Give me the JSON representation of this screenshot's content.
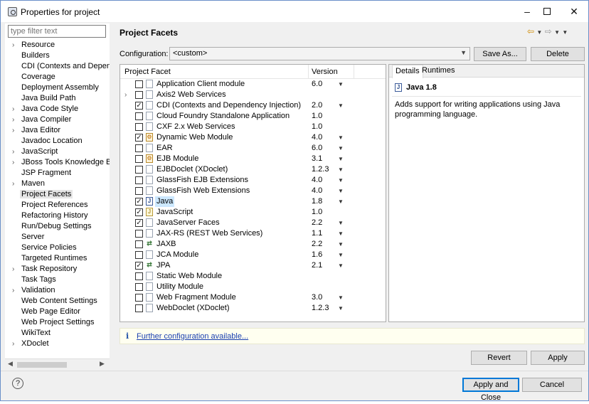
{
  "window": {
    "title": "Properties for project"
  },
  "filter": {
    "placeholder": "type filter text"
  },
  "sidebar": {
    "items": [
      {
        "label": "Resource",
        "expandable": true
      },
      {
        "label": "Builders",
        "expandable": false
      },
      {
        "label": "CDI (Contexts and Depende",
        "expandable": false
      },
      {
        "label": "Coverage",
        "expandable": false
      },
      {
        "label": "Deployment Assembly",
        "expandable": false
      },
      {
        "label": "Java Build Path",
        "expandable": false
      },
      {
        "label": "Java Code Style",
        "expandable": true
      },
      {
        "label": "Java Compiler",
        "expandable": true
      },
      {
        "label": "Java Editor",
        "expandable": true
      },
      {
        "label": "Javadoc Location",
        "expandable": false
      },
      {
        "label": "JavaScript",
        "expandable": true
      },
      {
        "label": "JBoss Tools Knowledge Bas",
        "expandable": true
      },
      {
        "label": "JSP Fragment",
        "expandable": false
      },
      {
        "label": "Maven",
        "expandable": true
      },
      {
        "label": "Project Facets",
        "expandable": false,
        "selected": true
      },
      {
        "label": "Project References",
        "expandable": false
      },
      {
        "label": "Refactoring History",
        "expandable": false
      },
      {
        "label": "Run/Debug Settings",
        "expandable": false
      },
      {
        "label": "Server",
        "expandable": false
      },
      {
        "label": "Service Policies",
        "expandable": false
      },
      {
        "label": "Targeted Runtimes",
        "expandable": false
      },
      {
        "label": "Task Repository",
        "expandable": true
      },
      {
        "label": "Task Tags",
        "expandable": false
      },
      {
        "label": "Validation",
        "expandable": true
      },
      {
        "label": "Web Content Settings",
        "expandable": false
      },
      {
        "label": "Web Page Editor",
        "expandable": false
      },
      {
        "label": "Web Project Settings",
        "expandable": false
      },
      {
        "label": "WikiText",
        "expandable": false
      },
      {
        "label": "XDoclet",
        "expandable": true
      }
    ]
  },
  "page": {
    "title": "Project Facets"
  },
  "configuration": {
    "label": "Configuration:",
    "value": "<custom>",
    "save_label": "Save As...",
    "delete_label": "Delete"
  },
  "facets": {
    "header_name": "Project Facet",
    "header_version": "Version",
    "rows": [
      {
        "name": "Application Client module",
        "version": "6.0",
        "checked": false,
        "icon": "doc",
        "dropdown": true
      },
      {
        "name": "Axis2 Web Services",
        "version": "",
        "checked": false,
        "icon": "doc",
        "expandable": true
      },
      {
        "name": "CDI (Contexts and Dependency Injection)",
        "version": "2.0",
        "checked": true,
        "icon": "doc",
        "dropdown": true
      },
      {
        "name": "Cloud Foundry Standalone Application",
        "version": "1.0",
        "checked": false,
        "icon": "doc"
      },
      {
        "name": "CXF 2.x Web Services",
        "version": "1.0",
        "checked": false,
        "icon": "doc"
      },
      {
        "name": "Dynamic Web Module",
        "version": "4.0",
        "checked": true,
        "icon": "gear",
        "dropdown": true
      },
      {
        "name": "EAR",
        "version": "6.0",
        "checked": false,
        "icon": "doc",
        "dropdown": true
      },
      {
        "name": "EJB Module",
        "version": "3.1",
        "checked": false,
        "icon": "gear",
        "dropdown": true
      },
      {
        "name": "EJBDoclet (XDoclet)",
        "version": "1.2.3",
        "checked": false,
        "icon": "doc",
        "dropdown": true
      },
      {
        "name": "GlassFish EJB Extensions",
        "version": "4.0",
        "checked": false,
        "icon": "doc",
        "dropdown": true
      },
      {
        "name": "GlassFish Web Extensions",
        "version": "4.0",
        "checked": false,
        "icon": "doc",
        "dropdown": true
      },
      {
        "name": "Java",
        "version": "1.8",
        "checked": true,
        "icon": "java",
        "dropdown": true,
        "selected": true
      },
      {
        "name": "JavaScript",
        "version": "1.0",
        "checked": true,
        "icon": "js"
      },
      {
        "name": "JavaServer Faces",
        "version": "2.2",
        "checked": true,
        "icon": "doc",
        "dropdown": true
      },
      {
        "name": "JAX-RS (REST Web Services)",
        "version": "1.1",
        "checked": false,
        "icon": "doc",
        "dropdown": true
      },
      {
        "name": "JAXB",
        "version": "2.2",
        "checked": false,
        "icon": "arrows",
        "dropdown": true
      },
      {
        "name": "JCA Module",
        "version": "1.6",
        "checked": false,
        "icon": "doc",
        "dropdown": true
      },
      {
        "name": "JPA",
        "version": "2.1",
        "checked": true,
        "icon": "arrows",
        "dropdown": true
      },
      {
        "name": "Static Web Module",
        "version": "",
        "checked": false,
        "icon": "doc"
      },
      {
        "name": "Utility Module",
        "version": "",
        "checked": false,
        "icon": "doc"
      },
      {
        "name": "Web Fragment Module",
        "version": "3.0",
        "checked": false,
        "icon": "doc",
        "dropdown": true
      },
      {
        "name": "WebDoclet (XDoclet)",
        "version": "1.2.3",
        "checked": false,
        "icon": "doc",
        "dropdown": true
      }
    ]
  },
  "details": {
    "tab_details": "Details",
    "tab_runtimes": "Runtimes",
    "title": "Java 1.8",
    "description": "Adds support for writing applications using Java programming language."
  },
  "info": {
    "link": "Further configuration available..."
  },
  "buttons": {
    "revert": "Revert",
    "apply": "Apply",
    "apply_close": "Apply and Close",
    "cancel": "Cancel"
  }
}
